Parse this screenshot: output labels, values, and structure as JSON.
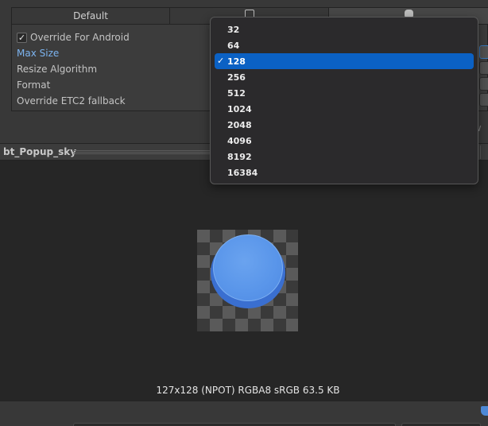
{
  "platform_tabs": {
    "default_label": "Default",
    "standalone_icon": "monitor-icon",
    "android_icon": "android-icon"
  },
  "properties": {
    "override_checked": true,
    "override_label": "Override For Android",
    "max_size_label": "Max Size",
    "resize_label": "Resize Algorithm",
    "format_label": "Format",
    "etc2_label": "Override ETC2 fallback"
  },
  "preview": {
    "title": "bt_Popup_sky",
    "info": "127x128 (NPOT)  RGBA8 sRGB   63.5 KB"
  },
  "max_size_dropdown": {
    "options": [
      "32",
      "64",
      "128",
      "256",
      "512",
      "1024",
      "2048",
      "4096",
      "8192",
      "16384"
    ],
    "selected": "128",
    "check_glyph": "✓"
  },
  "colors": {
    "accent": "#0b61c4",
    "highlight_label": "#7cb4f0",
    "sprite_blue": "#5a96ea"
  }
}
